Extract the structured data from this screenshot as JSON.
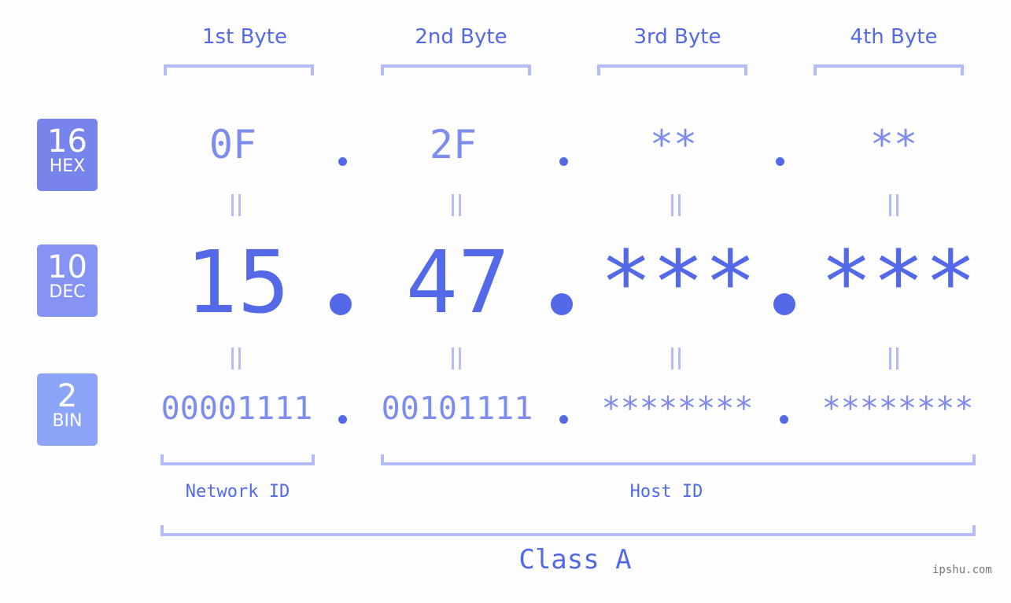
{
  "colors": {
    "accent": "#5469e8",
    "secondary_text": "#7e8cec",
    "bracket": "#b3bcf6",
    "hex_badge": "#7684ec",
    "dec_badge": "#8593f2",
    "bin_badge": "#8da5f8",
    "background": "#fcfdfc"
  },
  "byte_headers": [
    "1st Byte",
    "2nd Byte",
    "3rd Byte",
    "4th Byte"
  ],
  "rows": {
    "hex": {
      "badge_number": "16",
      "badge_label": "HEX",
      "values": [
        "0F",
        "2F",
        "**",
        "**"
      ]
    },
    "dec": {
      "badge_number": "10",
      "badge_label": "DEC",
      "values": [
        "15",
        "47",
        "***",
        "***"
      ]
    },
    "bin": {
      "badge_number": "2",
      "badge_label": "BIN",
      "values": [
        "00001111",
        "00101111",
        "********",
        "********"
      ]
    }
  },
  "equals_glyph": "=",
  "segments": {
    "network_label": "Network ID",
    "host_label": "Host ID",
    "class_label": "Class A"
  },
  "watermark": "ipshu.com"
}
